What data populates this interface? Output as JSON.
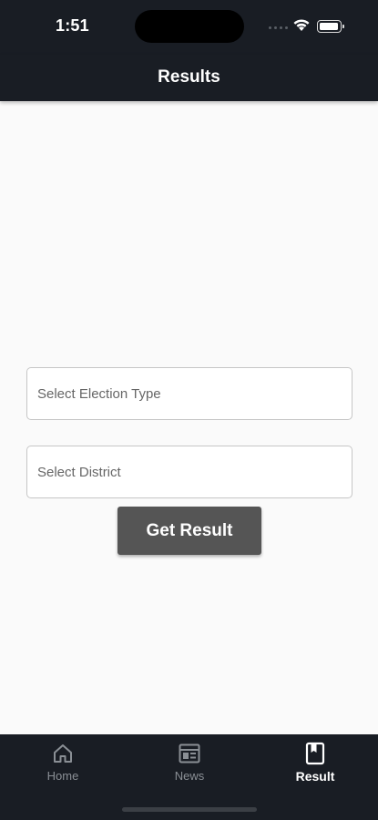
{
  "status_bar": {
    "time": "1:51"
  },
  "app_bar": {
    "title": "Results"
  },
  "form": {
    "election_type": {
      "placeholder": "Select Election Type"
    },
    "district": {
      "placeholder": "Select District"
    },
    "submit_label": "Get Result"
  },
  "bottom_nav": {
    "items": [
      {
        "label": "Home",
        "icon": "home-icon",
        "active": false
      },
      {
        "label": "News",
        "icon": "news-icon",
        "active": false
      },
      {
        "label": "Result",
        "icon": "result-icon",
        "active": true
      }
    ]
  },
  "colors": {
    "bar_background": "#191d24",
    "page_background": "#fafafa",
    "button_background": "#555555",
    "nav_inactive": "#8a8f95",
    "nav_active": "#ffffff"
  }
}
